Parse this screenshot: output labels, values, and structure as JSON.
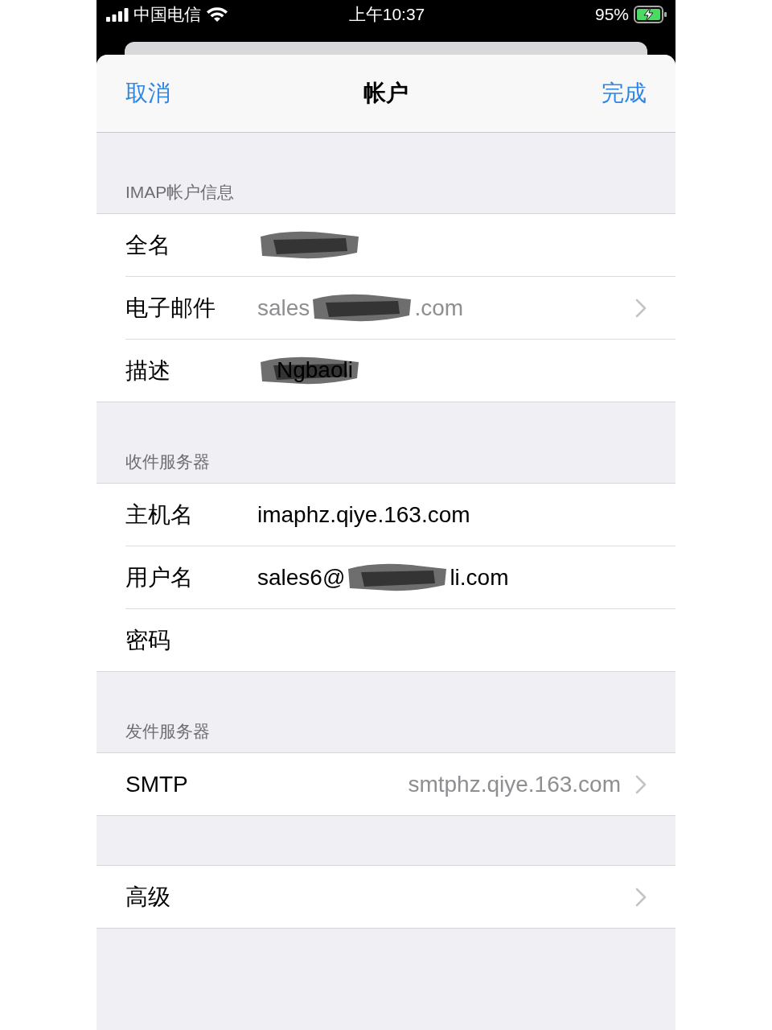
{
  "status_bar": {
    "carrier": "中国电信",
    "time": "上午10:37",
    "battery": "95%",
    "charging": true
  },
  "nav": {
    "left": "取消",
    "title": "帐户",
    "right": "完成"
  },
  "sections": [
    {
      "header": "IMAP帐户信息",
      "rows": [
        {
          "kind": "field",
          "label": "全名",
          "value": [
            {
              "kind": "redaction"
            }
          ]
        },
        {
          "kind": "field-link",
          "label": "电子邮件",
          "muted": true,
          "value": [
            {
              "kind": "text",
              "text": "sales"
            },
            {
              "kind": "redaction"
            },
            {
              "kind": "text",
              "text": ".com"
            }
          ]
        },
        {
          "kind": "field",
          "label": "描述",
          "muted": false,
          "value": [
            {
              "kind": "redaction",
              "text": "Ngbaoli"
            }
          ]
        }
      ]
    },
    {
      "header": "收件服务器",
      "rows": [
        {
          "kind": "field",
          "label": "主机名",
          "muted": false,
          "value": [
            {
              "kind": "text",
              "text": "imaphz.qiye.163.com"
            }
          ]
        },
        {
          "kind": "field",
          "label": "用户名",
          "muted": false,
          "value": [
            {
              "kind": "text",
              "text": "sales6@"
            },
            {
              "kind": "redaction"
            },
            {
              "kind": "text",
              "text": "li.com"
            }
          ]
        },
        {
          "kind": "field",
          "label": "密码",
          "value": []
        }
      ]
    },
    {
      "header": "发件服务器",
      "rows": [
        {
          "kind": "link",
          "label": "SMTP",
          "muted": true,
          "value": [
            {
              "kind": "text",
              "text": "smtphz.qiye.163.com"
            }
          ]
        }
      ]
    },
    {
      "rows": [
        {
          "kind": "link",
          "label": "高级",
          "value": []
        }
      ]
    }
  ]
}
